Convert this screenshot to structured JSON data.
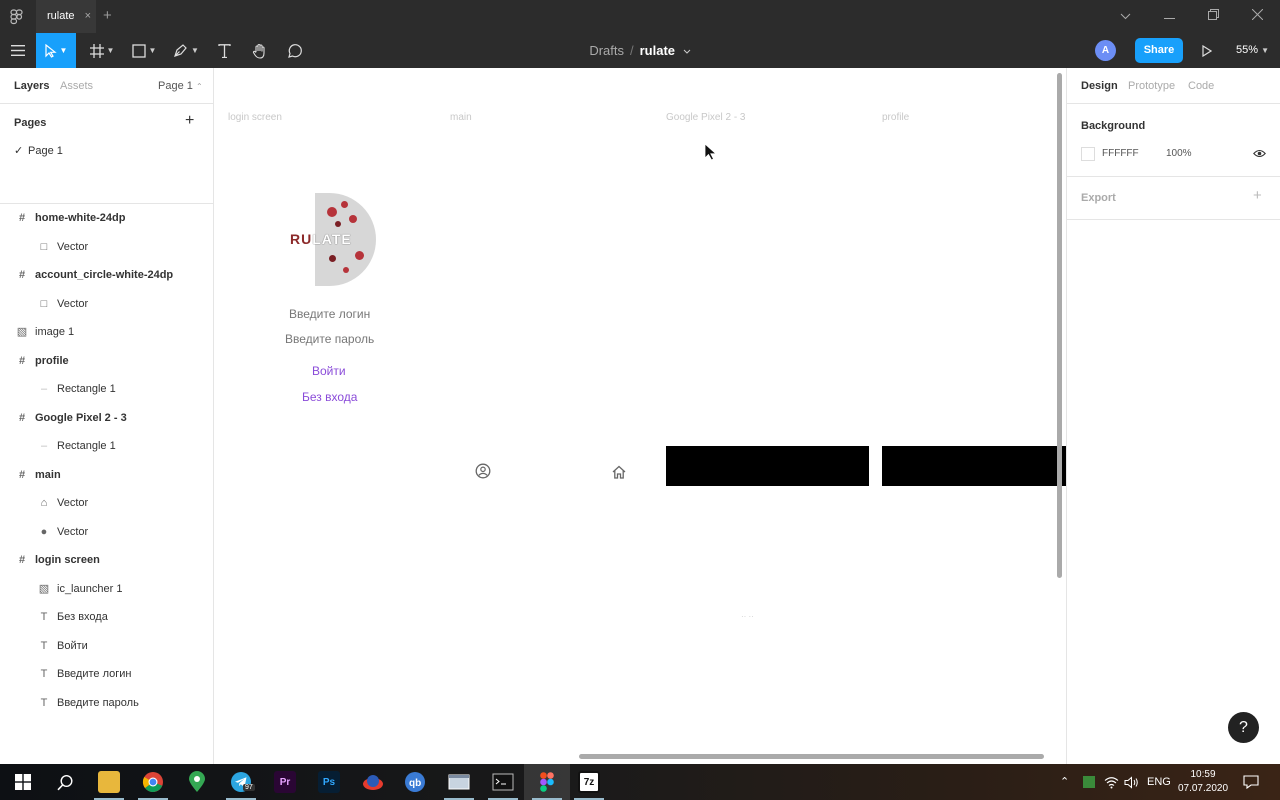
{
  "titlebar": {
    "tab_label": "rulate",
    "tab_close": "×",
    "new_tab": "+"
  },
  "toolbar": {
    "breadcrumb_drafts": "Drafts",
    "breadcrumb_sep": "/",
    "file_name": "rulate",
    "avatar_initial": "A",
    "share_label": "Share",
    "zoom_label": "55%"
  },
  "left_panel": {
    "tabs": {
      "layers": "Layers",
      "assets": "Assets",
      "page": "Page 1"
    },
    "pages_header": "Pages",
    "pages": [
      {
        "name": "Page 1",
        "selected": true
      }
    ],
    "layers": [
      {
        "name": "home-white-24dp",
        "type": "frame"
      },
      {
        "name": "Vector",
        "type": "vector"
      },
      {
        "name": "account_circle-white-24dp",
        "type": "frame"
      },
      {
        "name": "Vector",
        "type": "vector"
      },
      {
        "name": "image 1",
        "type": "image"
      },
      {
        "name": "profile",
        "type": "frame"
      },
      {
        "name": "Rectangle 1",
        "type": "rectangle"
      },
      {
        "name": "Google Pixel 2 - 3",
        "type": "frame"
      },
      {
        "name": "Rectangle 1",
        "type": "rectangle"
      },
      {
        "name": "main",
        "type": "frame"
      },
      {
        "name": "Vector",
        "type": "vector-home"
      },
      {
        "name": "Vector",
        "type": "vector-account"
      },
      {
        "name": "login screen",
        "type": "frame"
      },
      {
        "name": "ic_launcher 1",
        "type": "image"
      },
      {
        "name": "Без входа",
        "type": "text"
      },
      {
        "name": "Войти",
        "type": "text"
      },
      {
        "name": "Введите логин",
        "type": "text"
      },
      {
        "name": "Введите пароль",
        "type": "text"
      }
    ]
  },
  "canvas": {
    "frame_labels": [
      "login screen",
      "main",
      "Google Pixel 2 - 3",
      "profile"
    ],
    "logo_text_left": "RU",
    "logo_text_right": "LATE",
    "login_placeholder": "Введите логин",
    "password_placeholder": "Введите пароль",
    "login_button": "Войти",
    "guest_button": "Без входа"
  },
  "right_panel": {
    "tabs": {
      "design": "Design",
      "prototype": "Prototype",
      "code": "Code"
    },
    "background_header": "Background",
    "background_hex": "FFFFFF",
    "background_opacity": "100%",
    "export_label": "Export",
    "export_add": "+",
    "help": "?"
  },
  "taskbar": {
    "lang": "ENG",
    "time": "10:59",
    "date": "07.07.2020",
    "telegram_badge": "97",
    "apps": [
      "start-icon",
      "search-icon",
      "file-explorer-icon",
      "chrome-icon",
      "maps-icon",
      "telegram-icon",
      "premiere-icon",
      "photoshop-icon",
      "app-icon",
      "qbittorrent-icon",
      "app-window-icon",
      "terminal-icon",
      "figma-icon",
      "7zip-icon"
    ]
  },
  "colors": {
    "accent": "#18a0fb",
    "link": "#8a4bd9",
    "dark_chrome": "#2c2c2c"
  }
}
